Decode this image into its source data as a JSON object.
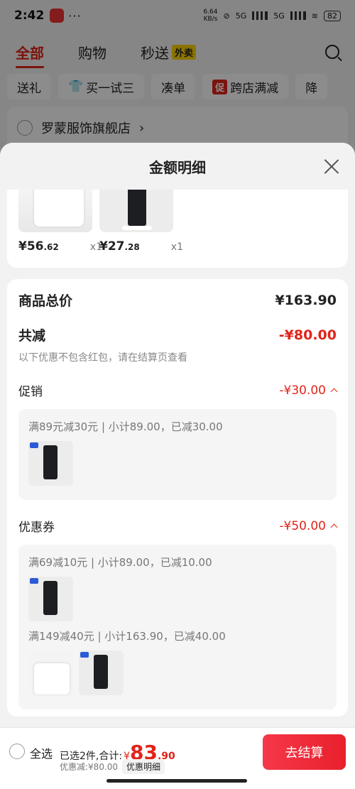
{
  "status_bar": {
    "time": "2:42",
    "dots": "···",
    "net_speed": "6.64",
    "net_unit": "KB/s",
    "net1": "5G",
    "net2": "5G",
    "battery": "82"
  },
  "top_tabs": {
    "all": "全部",
    "shopping": "购物",
    "flash": "秒送",
    "flash_badge": "外卖"
  },
  "filter_chips": [
    "送礼",
    "买一试三",
    "凑单",
    "跨店满减",
    "降"
  ],
  "promo_badge": "促",
  "shop": {
    "name": "罗蒙服饰旗舰店",
    "arrow": "›"
  },
  "sheet": {
    "title": "金额明细",
    "products": [
      {
        "price_int": "¥56",
        "price_dec": ".62",
        "qty": "x1"
      },
      {
        "price_int": "¥27",
        "price_dec": ".28",
        "qty": "x1"
      }
    ],
    "total_label": "商品总价",
    "total_value": "¥163.90",
    "discount_label": "共减",
    "discount_value": "-¥80.00",
    "discount_note": "以下优惠不包含红包，请在结算页查看",
    "promo": {
      "label": "促销",
      "value": "-¥30.00",
      "rule": "满89元减30元 | 小计89.00，已减30.00"
    },
    "coupon": {
      "label": "优惠券",
      "value": "-¥50.00",
      "rule1": "满69减10元 | 小计89.00，已减10.00",
      "rule2": "满149减40元 | 小计163.90，已减40.00"
    }
  },
  "bottom_bar": {
    "select_all": "全选",
    "selected_text": "已选2件,合计:",
    "currency": "¥",
    "total_int": "83",
    "total_dec": ".90",
    "discount_text": "优惠减:¥80.00",
    "detail_button": "优惠明细",
    "checkout": "去结算"
  },
  "colors": {
    "accent": "#e2231a",
    "checkout_start": "#f5384a",
    "checkout_end": "#e8202b"
  }
}
